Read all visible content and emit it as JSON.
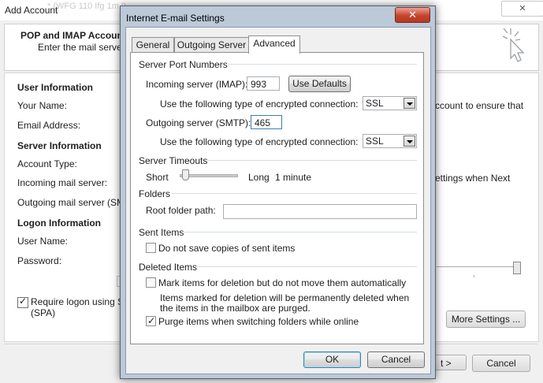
{
  "bg_window": {
    "title": "Add Account",
    "faded_text": "* (WFG 110 Ifg 1m 9-",
    "close_glyph": "✕",
    "header_title": "POP and IMAP Account",
    "header_subtitle": "Enter the mail server",
    "sections": {
      "user_info": "User Information",
      "server_info": "Server Information",
      "logon_info": "Logon Information"
    },
    "labels": {
      "your_name": "Your Name:",
      "email": "Email Address:",
      "account_type": "Account Type:",
      "incoming": "Incoming mail server:",
      "outgoing": "Outgoing mail server (SM",
      "user_name": "User Name:",
      "password": "Password:"
    },
    "spa_line1": "Require logon using S",
    "spa_line2": "(SPA)",
    "right_text_1": "ccount to ensure that",
    "right_text_2": "ettings when Next",
    "more_settings": "More Settings ...",
    "next_partial": "t >",
    "cancel": "Cancel"
  },
  "dialog": {
    "title": "Internet E-mail Settings",
    "close_glyph": "✕",
    "tabs": [
      "General",
      "Outgoing Server",
      "Advanced"
    ],
    "active_tab": "Advanced",
    "port_numbers": {
      "heading": "Server Port Numbers",
      "incoming_label": "Incoming server (IMAP):",
      "incoming_value": "993",
      "use_defaults": "Use Defaults",
      "encrypt_label": "Use the following type of encrypted connection:",
      "incoming_encryption": "SSL",
      "outgoing_label": "Outgoing server (SMTP):",
      "outgoing_value": "465",
      "outgoing_encryption": "SSL"
    },
    "timeouts": {
      "heading": "Server Timeouts",
      "short": "Short",
      "long": "Long",
      "value": "1 minute",
      "slider_level": 0.05
    },
    "folders": {
      "heading": "Folders",
      "root_label": "Root folder path:",
      "root_value": ""
    },
    "sent_items": {
      "heading": "Sent Items",
      "dont_save": "Do not save copies of sent items",
      "dont_save_checked": false
    },
    "deleted_items": {
      "heading": "Deleted Items",
      "mark_label": "Mark items for deletion but do not move them automatically",
      "mark_checked": false,
      "note_line1": "Items marked for deletion will be permanently deleted when",
      "note_line2": "the items in the mailbox are purged.",
      "purge_label": "Purge items when switching folders while online",
      "purge_checked": true
    },
    "ok": "OK",
    "cancel": "Cancel"
  },
  "colors": {
    "dialog_frame": "#bcc9d9",
    "close_button": "#c7432c",
    "focus_border": "#3c7fb1"
  }
}
